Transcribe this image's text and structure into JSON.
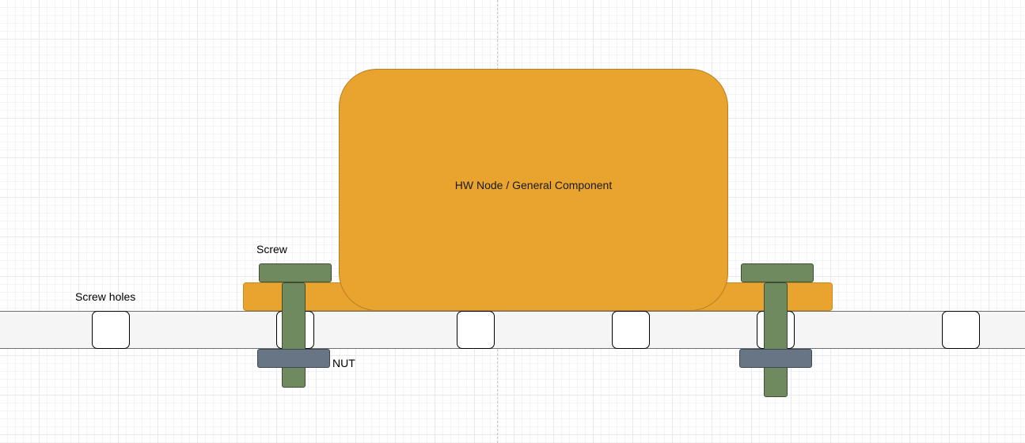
{
  "diagram": {
    "node_label": "HW Node / General Component",
    "screw_label": "Screw",
    "screw_holes_label": "Screw holes",
    "nut_label": "NUT"
  },
  "colors": {
    "component": "#e8a42e",
    "screw": "#6f8a5f",
    "nut": "#677585",
    "rail": "#f5f5f5"
  }
}
